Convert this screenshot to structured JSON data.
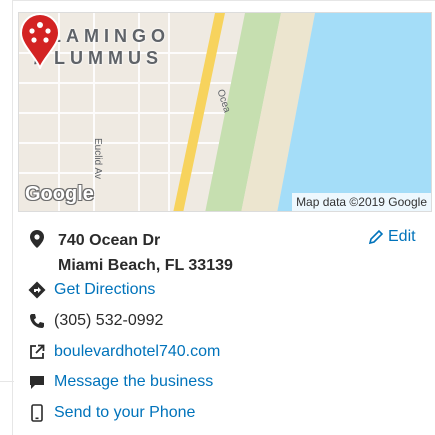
{
  "map": {
    "neighborhood_line1": "FLAMINGO",
    "neighborhood_line2": "/ LUMMUS",
    "street_euclid": "Euclid Av",
    "street_ocean": "Ocea",
    "logo": "Google",
    "attribution": "Map data ©2019 Google"
  },
  "address": {
    "line1": "740 Ocean Dr",
    "line2": "Miami Beach, FL 33139",
    "edit_label": "Edit"
  },
  "actions": {
    "directions": "Get Directions",
    "phone": "(305) 532-0992",
    "website": "boulevardhotel740.com",
    "message": "Message the business",
    "send_phone": "Send to your Phone"
  },
  "colors": {
    "link": "#0073bb",
    "pin": "#d32323",
    "water": "#a4ddf8"
  }
}
